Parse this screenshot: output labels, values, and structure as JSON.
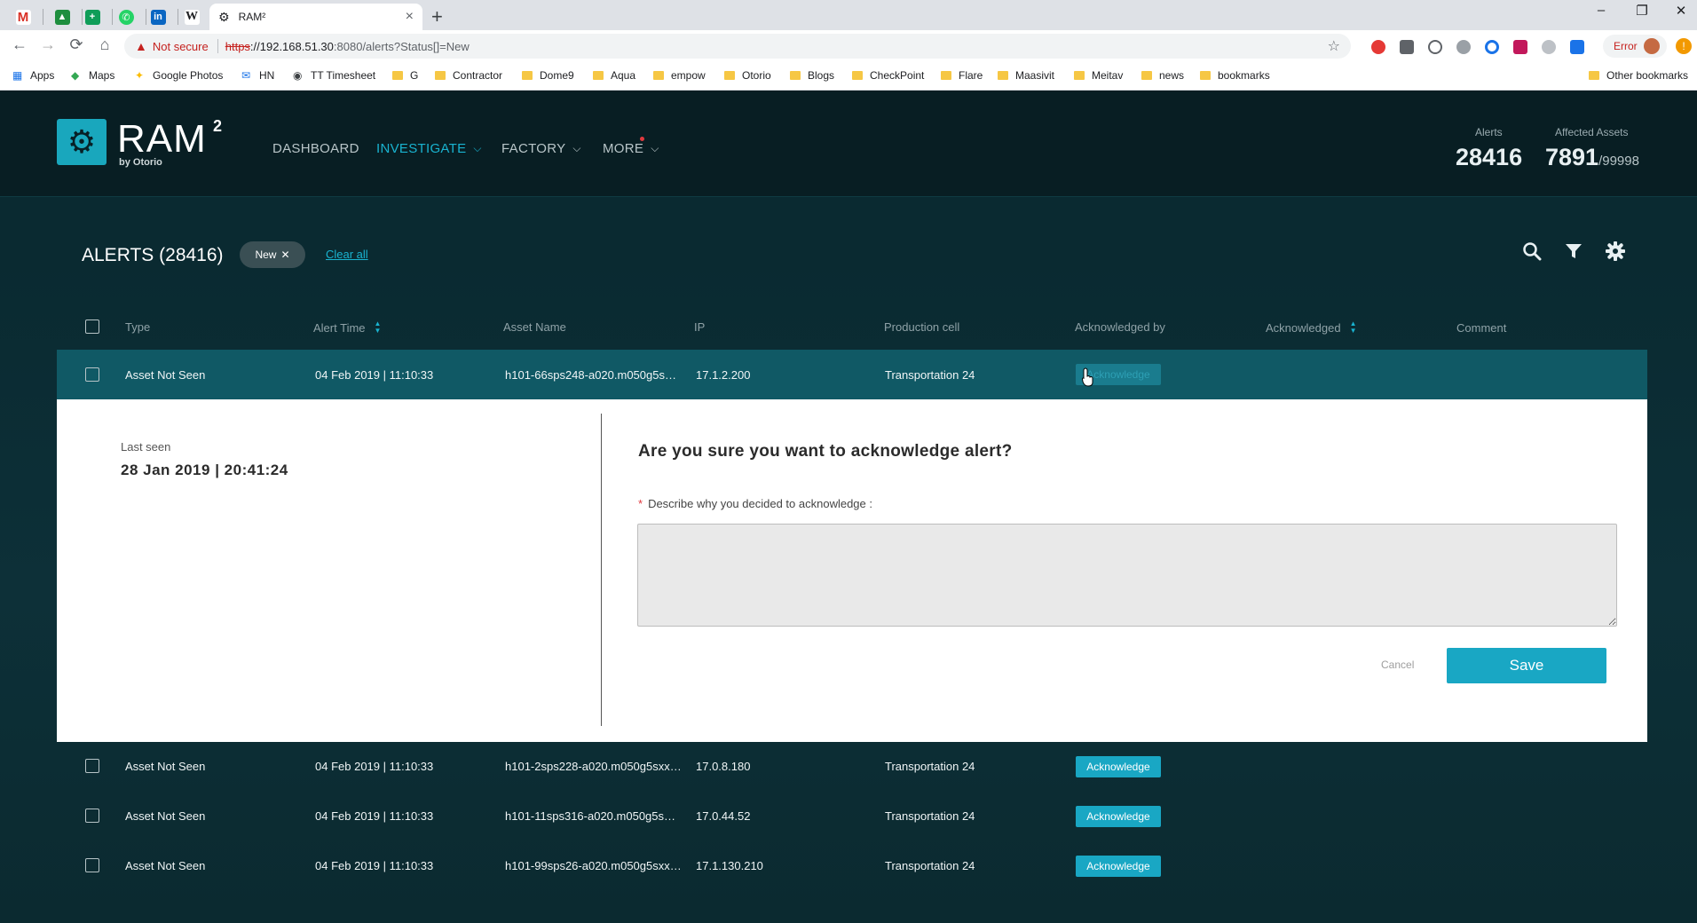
{
  "browser": {
    "tab_title": "RAM²",
    "new_tab_symbol": "+",
    "tab_close": "×",
    "address": {
      "warning": "Not secure",
      "protocol": "https",
      "host": "://192.168.51.30",
      "path": ":8080/alerts?Status[]=New"
    },
    "error_label": "Error",
    "bookmarks": [
      "Apps",
      "Maps",
      "Google Photos",
      "HN",
      "TT Timesheet",
      "G",
      "Contractor",
      "Dome9",
      "Aqua",
      "empow",
      "Otorio",
      "Blogs",
      "CheckPoint",
      "Flare",
      "Maasivit",
      "Meitav",
      "news",
      "bookmarks"
    ],
    "other_bookmarks": "Other bookmarks"
  },
  "header": {
    "logo_text": "RAM",
    "logo_sup": "2",
    "logo_by": "by Otorio",
    "nav": [
      {
        "label": "DASHBOARD"
      },
      {
        "label": "INVESTIGATE"
      },
      {
        "label": "FACTORY"
      },
      {
        "label": "MORE"
      }
    ],
    "stats": {
      "alerts_label": "Alerts",
      "alerts_value": "28416",
      "assets_label": "Affected Assets",
      "assets_value": "7891",
      "assets_total": "/99998"
    }
  },
  "alerts": {
    "title": "ALERTS (28416)",
    "filter_chip": "New",
    "clear_all": "Clear all",
    "columns": [
      "Type",
      "Alert Time",
      "Asset Name",
      "IP",
      "Production cell",
      "Acknowledged by",
      "Acknowledged",
      "Comment"
    ],
    "rows": [
      {
        "type": "Asset Not Seen",
        "time": "04 Feb 2019 | 11:10:33",
        "asset": "h101-66sps248-a020.m050g5s…",
        "ip": "17.1.2.200",
        "cell": "Transportation 24",
        "ack_label": "Acknowledge"
      },
      {
        "type": "Asset Not Seen",
        "time": "04 Feb 2019 | 11:10:33",
        "asset": "h101-2sps228-a020.m050g5sxx…",
        "ip": "17.0.8.180",
        "cell": "Transportation 24",
        "ack_label": "Acknowledge"
      },
      {
        "type": "Asset Not Seen",
        "time": "04 Feb 2019 | 11:10:33",
        "asset": "h101-11sps316-a020.m050g5s…",
        "ip": "17.0.44.52",
        "cell": "Transportation 24",
        "ack_label": "Acknowledge"
      },
      {
        "type": "Asset Not Seen",
        "time": "04 Feb 2019 | 11:10:33",
        "asset": "h101-99sps26-a020.m050g5sxx…",
        "ip": "17.1.130.210",
        "cell": "Transportation 24",
        "ack_label": "Acknowledge"
      }
    ],
    "detail": {
      "last_seen_label": "Last seen",
      "last_seen_value": "28 Jan 2019 | 20:41:24",
      "question": "Are you sure you want to acknowledge alert?",
      "required_mark": "*",
      "describe_label": "Describe why you decided to acknowledge :",
      "comment_value": "",
      "cancel_label": "Cancel",
      "save_label": "Save"
    }
  },
  "colors": {
    "accent": "#19a7c4",
    "highlight_row": "#105965",
    "app_bg": "#0a2a30"
  }
}
